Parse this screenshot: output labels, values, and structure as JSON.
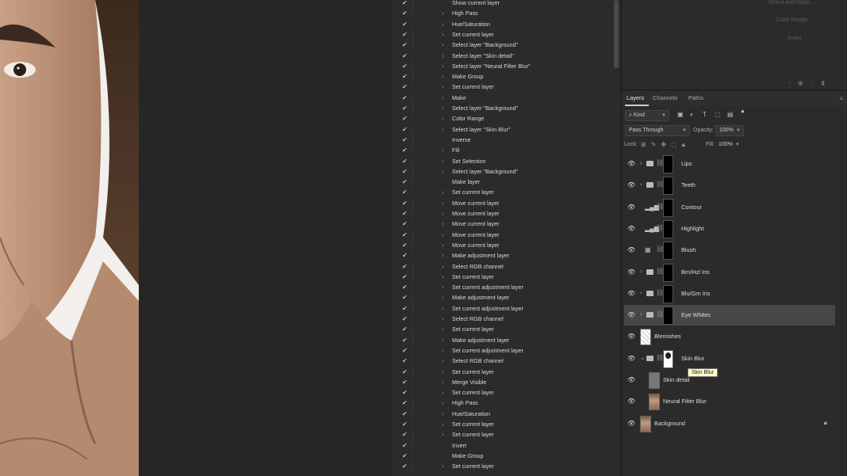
{
  "colors": {
    "panel": "#2b2b2b",
    "selected_row": "#474747",
    "tooltip_bg": "#ffffc8"
  },
  "actions": [
    {
      "label": "Show current layer",
      "expand": false
    },
    {
      "label": "High Pass",
      "expand": true
    },
    {
      "label": "Hue/Saturation",
      "expand": true
    },
    {
      "label": "Set current layer",
      "expand": true
    },
    {
      "label": "Select layer \"Background\"",
      "expand": true
    },
    {
      "label": "Select layer \"Skin detail\"",
      "expand": true
    },
    {
      "label": "Select layer \"Neural Filter Blur\"",
      "expand": true
    },
    {
      "label": "Make Group",
      "expand": true
    },
    {
      "label": "Set current layer",
      "expand": true
    },
    {
      "label": "Make",
      "expand": true
    },
    {
      "label": "Select layer \"Background\"",
      "expand": true
    },
    {
      "label": "Color Range",
      "expand": true
    },
    {
      "label": "Select layer \"Skin Blur\"",
      "expand": true
    },
    {
      "label": "Inverse",
      "expand": false
    },
    {
      "label": "Fill",
      "expand": true
    },
    {
      "label": "Set Selection",
      "expand": true
    },
    {
      "label": "Select layer \"Background\"",
      "expand": true
    },
    {
      "label": "Make layer",
      "expand": false
    },
    {
      "label": "Set current layer",
      "expand": true
    },
    {
      "label": "Move current layer",
      "expand": true
    },
    {
      "label": "Move current layer",
      "expand": true
    },
    {
      "label": "Move current layer",
      "expand": true
    },
    {
      "label": "Move current layer",
      "expand": true
    },
    {
      "label": "Move current layer",
      "expand": true
    },
    {
      "label": "Make adjustment layer",
      "expand": true
    },
    {
      "label": "Select RGB channel",
      "expand": true
    },
    {
      "label": "Set current layer",
      "expand": true
    },
    {
      "label": "Set current adjustment layer",
      "expand": true
    },
    {
      "label": "Make adjustment layer",
      "expand": true
    },
    {
      "label": "Set current adjustment layer",
      "expand": true
    },
    {
      "label": "Select RGB channel",
      "expand": true
    },
    {
      "label": "Set current layer",
      "expand": true
    },
    {
      "label": "Make adjustment layer",
      "expand": true
    },
    {
      "label": "Set current adjustment layer",
      "expand": true
    },
    {
      "label": "Select RGB channel",
      "expand": true
    },
    {
      "label": "Set current layer",
      "expand": true
    },
    {
      "label": "Merge Visible",
      "expand": true
    },
    {
      "label": "Set current layer",
      "expand": true
    },
    {
      "label": "High Pass",
      "expand": true
    },
    {
      "label": "Hue/Saturation",
      "expand": true
    },
    {
      "label": "Set current layer",
      "expand": true
    },
    {
      "label": "Set current layer",
      "expand": true
    },
    {
      "label": "Invert",
      "expand": false
    },
    {
      "label": "Make Group",
      "expand": false
    },
    {
      "label": "Set current layer",
      "expand": true
    }
  ],
  "top_panel": {
    "ghost_buttons": [
      "Select and Mask...",
      "Color Range",
      "Invert"
    ]
  },
  "layers_panel": {
    "tabs": [
      "Layers",
      "Channels",
      "Paths"
    ],
    "filter_kind": "Kind",
    "blend_mode": "Pass Through",
    "opacity_label": "Opacity:",
    "opacity_value": "100%",
    "lock_label": "Lock:",
    "fill_label": "Fill:",
    "fill_value": "100%",
    "layers": [
      {
        "name": "Lips",
        "type": "group",
        "selected": false
      },
      {
        "name": "Teeth",
        "type": "group",
        "selected": false
      },
      {
        "name": "Contour",
        "type": "levels",
        "selected": false
      },
      {
        "name": "Highlight",
        "type": "levels",
        "selected": false
      },
      {
        "name": "Blush",
        "type": "huesat",
        "selected": false
      },
      {
        "name": "Brn/Hzl Iris",
        "type": "group",
        "selected": false
      },
      {
        "name": "Blu/Grn Iris",
        "type": "group",
        "selected": false
      },
      {
        "name": "Eye Whites",
        "type": "group",
        "selected": true
      },
      {
        "name": "Blemishes",
        "type": "pixel",
        "selected": false
      },
      {
        "name": "Skin Blur",
        "type": "group-open",
        "selected": false
      },
      {
        "name": "Skin detail",
        "type": "child",
        "selected": false
      },
      {
        "name": "Neural Filter Blur",
        "type": "child-photo",
        "selected": false
      },
      {
        "name": "Background",
        "type": "background",
        "selected": false
      }
    ]
  },
  "tooltip": "Skin Blur"
}
